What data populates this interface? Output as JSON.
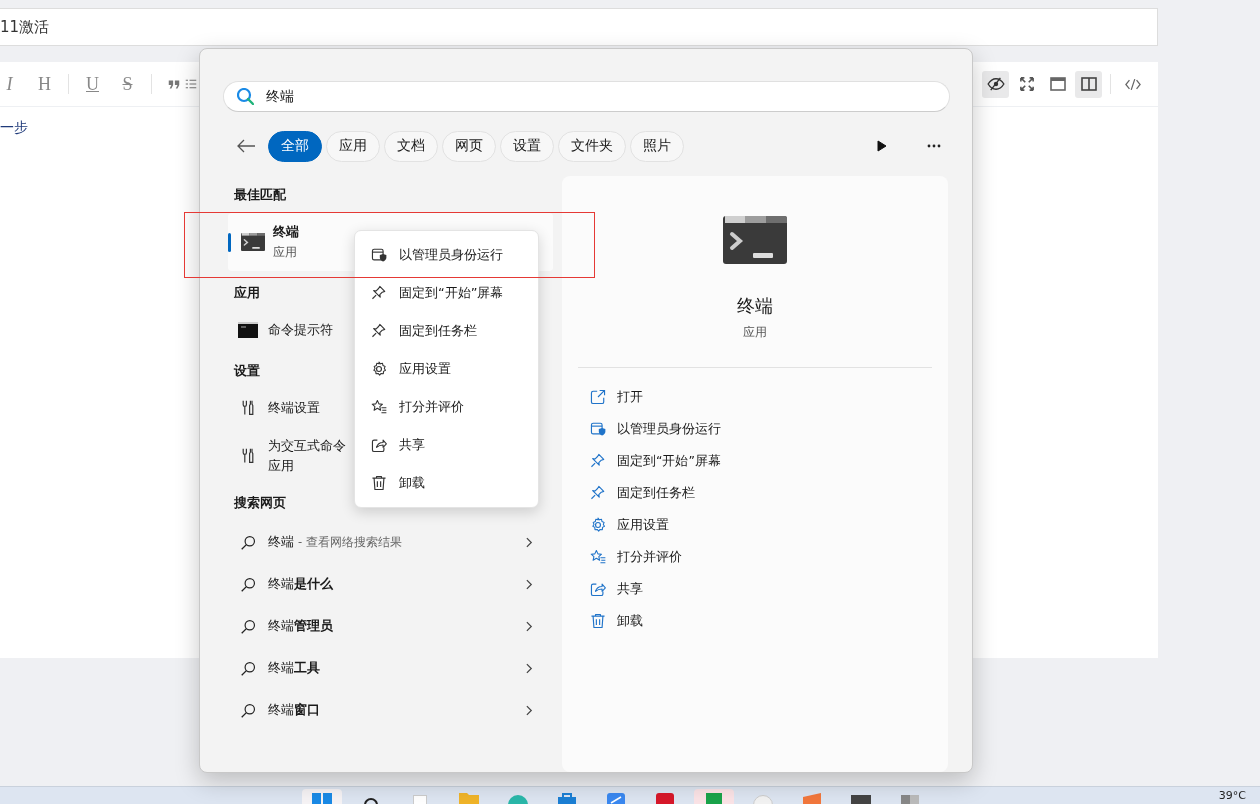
{
  "editor": {
    "title_value": "11激活",
    "body_text": "一步",
    "toolbar_left": [
      {
        "kind": "italic",
        "label": "I"
      },
      {
        "kind": "heading",
        "label": "H"
      },
      {
        "kind": "sep"
      },
      {
        "kind": "underline",
        "label": "U"
      },
      {
        "kind": "strike",
        "label": "S"
      },
      {
        "kind": "sep"
      },
      {
        "kind": "quote"
      },
      {
        "kind": "list"
      }
    ],
    "toolbar_right": [
      {
        "kind": "preview",
        "on": true
      },
      {
        "kind": "fullscreen",
        "on": false
      },
      {
        "kind": "window",
        "on": false
      },
      {
        "kind": "split",
        "on": true
      },
      {
        "kind": "sep"
      },
      {
        "kind": "code",
        "on": false
      }
    ]
  },
  "search": {
    "query": "终端",
    "filters": [
      {
        "label": "全部",
        "selected": true
      },
      {
        "label": "应用",
        "selected": false
      },
      {
        "label": "文档",
        "selected": false
      },
      {
        "label": "网页",
        "selected": false
      },
      {
        "label": "设置",
        "selected": false
      },
      {
        "label": "文件夹",
        "selected": false
      },
      {
        "label": "照片",
        "selected": false
      }
    ],
    "best_match": {
      "heading": "最佳匹配",
      "name": "终端",
      "type": "应用",
      "selected": true
    },
    "sections": [
      {
        "heading": "应用",
        "items": [
          {
            "kind": "cmd",
            "label": "命令提示符"
          }
        ]
      },
      {
        "heading": "设置",
        "items": [
          {
            "kind": "settings",
            "label": "终端设置"
          },
          {
            "kind": "settings",
            "label": "为交互式命令",
            "sublabel": "应用"
          }
        ]
      }
    ],
    "web": {
      "heading": "搜索网页",
      "items": [
        {
          "kind": "hint",
          "query": "终端",
          "hint": "- 查看网络搜索结果"
        },
        {
          "kind": "suggestion",
          "text": "终端**是什么**"
        },
        {
          "kind": "suggestion",
          "text": "终端**管理员**"
        },
        {
          "kind": "suggestion",
          "text": "终端**工具**"
        },
        {
          "kind": "suggestion",
          "text": "终端**窗口**"
        }
      ]
    },
    "context_menu": [
      {
        "kind": "shield",
        "label": "以管理员身份运行"
      },
      {
        "kind": "pin",
        "label": "固定到“开始”屏幕"
      },
      {
        "kind": "pin",
        "label": "固定到任务栏"
      },
      {
        "kind": "gear",
        "label": "应用设置"
      },
      {
        "kind": "star",
        "label": "打分并评价"
      },
      {
        "kind": "share",
        "label": "共享"
      },
      {
        "kind": "trash",
        "label": "卸载"
      }
    ],
    "detail": {
      "name": "终端",
      "type": "应用",
      "actions": [
        {
          "kind": "open",
          "label": "打开"
        },
        {
          "kind": "shield",
          "label": "以管理员身份运行"
        },
        {
          "kind": "pin",
          "label": "固定到“开始”屏幕"
        },
        {
          "kind": "pin",
          "label": "固定到任务栏"
        },
        {
          "kind": "gear",
          "label": "应用设置"
        },
        {
          "kind": "star",
          "label": "打分并评价"
        },
        {
          "kind": "share",
          "label": "共享"
        },
        {
          "kind": "trash",
          "label": "卸载"
        }
      ]
    }
  },
  "taskbar": {
    "weather": "39°C"
  }
}
